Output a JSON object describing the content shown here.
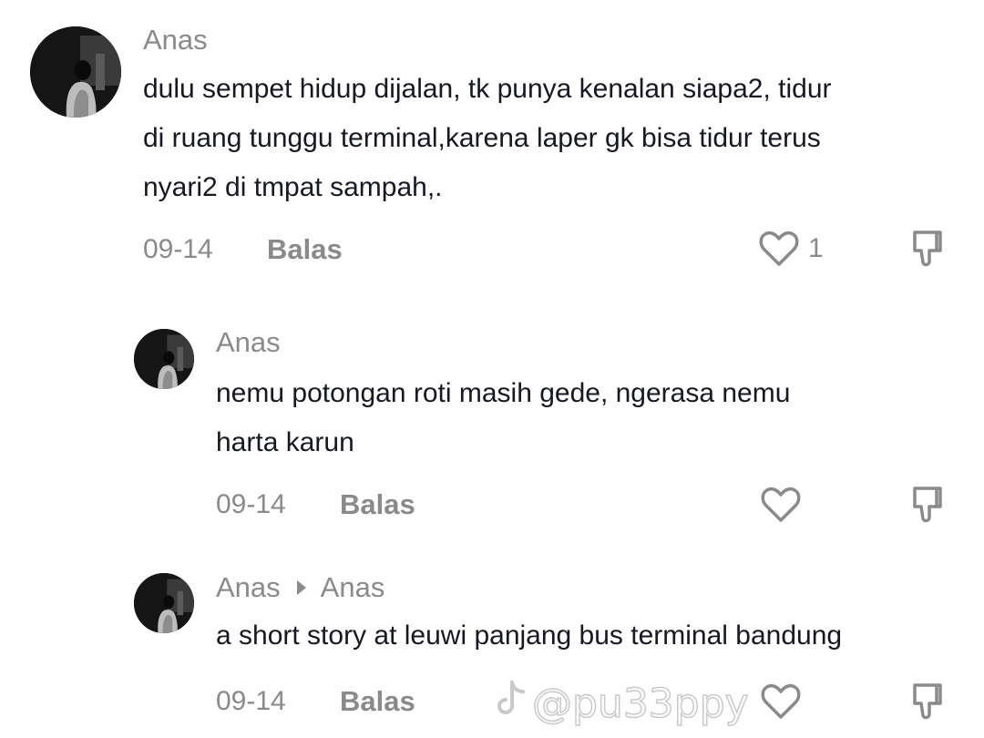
{
  "comments": [
    {
      "username": "Anas",
      "text": "dulu sempet hidup dijalan, tk punya kenalan siapa2, tidur\ndi ruang tunggu terminal,karena laper gk bisa tidur terus\nnyari2 di tmpat sampah,.",
      "date": "09-14",
      "reply_label": "Balas",
      "like_count": "1"
    },
    {
      "username": "Anas",
      "text": "nemu potongan roti masih gede, ngerasa nemu\nharta karun",
      "date": "09-14",
      "reply_label": "Balas",
      "like_count": ""
    },
    {
      "username": "Anas",
      "reply_to": "Anas",
      "text": "a short story at leuwi panjang bus terminal bandung",
      "date": "09-14",
      "reply_label": "Balas",
      "like_count": ""
    }
  ],
  "icons": {
    "like": "heart-outline-icon",
    "dislike": "thumbs-down-icon",
    "reply_indicator": "triangle-right-icon",
    "watermark": "tiktok-logo-icon"
  },
  "watermark": {
    "handle": "@pu33ppy"
  },
  "colors": {
    "username": "#8a8a8a",
    "text": "#161823",
    "meta": "#8a8a8a",
    "background": "#ffffff"
  }
}
